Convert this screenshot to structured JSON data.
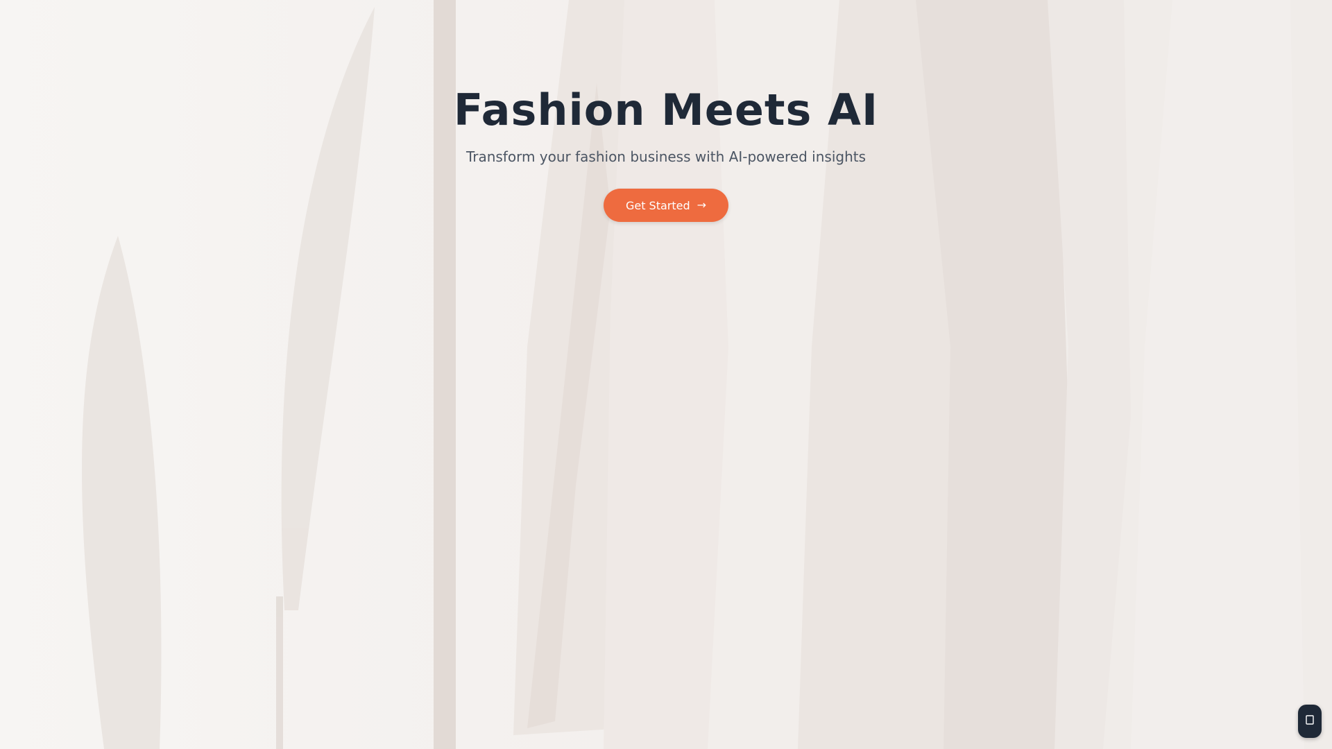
{
  "hero": {
    "title": "Fashion Meets AI",
    "subtitle": "Transform your fashion business with AI-powered insights",
    "cta_label": "Get Started",
    "cta_icon": "arrow-right-icon"
  },
  "floating_button": {
    "icon": "chat-icon"
  },
  "colors": {
    "accent": "#ee6b3f",
    "title": "#1f2937",
    "subtitle": "#4b5563",
    "background": "#f6f3f1"
  }
}
